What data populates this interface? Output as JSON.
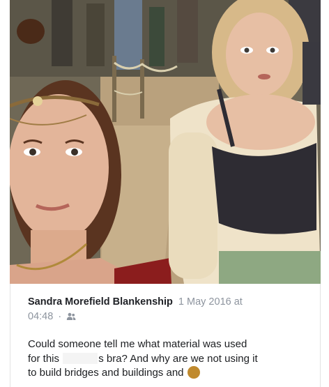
{
  "post": {
    "author": "Sandra Morefield Blankenship",
    "date": "1 May 2016 at",
    "time": "04:48",
    "separator": "·",
    "audience_icon": "friends-icon",
    "text_line1": "Could someone tell me what material was used",
    "text_line2_a": "for this ",
    "text_line2_b": "s bra? And why are we not using it",
    "text_line3": "to build bridges and buildings and "
  },
  "photo": {
    "description_icon": "photo",
    "palette": {
      "ground": "#b9a17d",
      "crowd": "#5e5a4e",
      "skin": "#e3b59a",
      "hair_left": "#5a3420",
      "hair_right": "#d7b989",
      "blouse": "#efe3c9",
      "corset": "#2e2c33",
      "skirt": "#8ea882"
    }
  }
}
